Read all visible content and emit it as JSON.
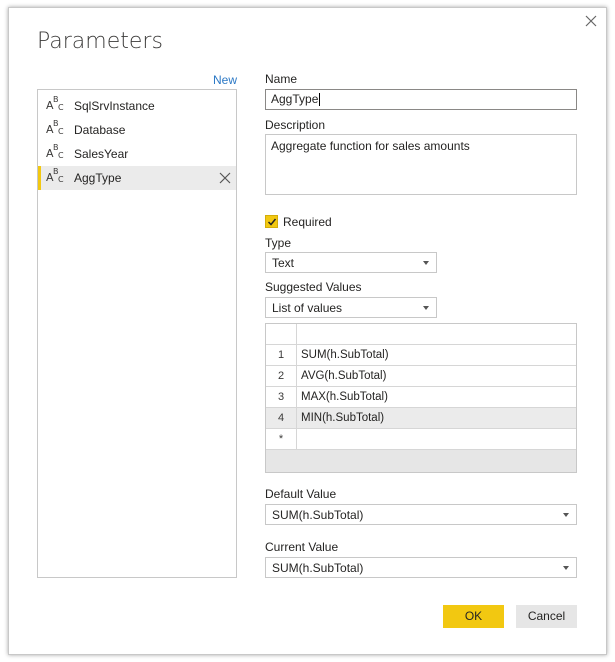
{
  "dialog": {
    "title": "Parameters",
    "new_link": "New",
    "close_icon": "close-icon"
  },
  "parameters": [
    {
      "label": "SqlSrvInstance",
      "icon": "text-type-icon"
    },
    {
      "label": "Database",
      "icon": "text-type-icon"
    },
    {
      "label": "SalesYear",
      "icon": "text-type-icon"
    },
    {
      "label": "AggType",
      "icon": "text-type-icon",
      "selected": true
    }
  ],
  "form": {
    "name_label": "Name",
    "name_value": "AggType",
    "description_label": "Description",
    "description_value": "Aggregate function for sales amounts",
    "required_label": "Required",
    "required_checked": true,
    "type_label": "Type",
    "type_value": "Text",
    "suggested_label": "Suggested Values",
    "suggested_value": "List of values",
    "values_table": {
      "rows": [
        {
          "num": "1",
          "value": "SUM(h.SubTotal)"
        },
        {
          "num": "2",
          "value": "AVG(h.SubTotal)"
        },
        {
          "num": "3",
          "value": "MAX(h.SubTotal)"
        },
        {
          "num": "4",
          "value": "MIN(h.SubTotal)"
        }
      ],
      "new_row_marker": "*"
    },
    "default_label": "Default Value",
    "default_value": "SUM(h.SubTotal)",
    "current_label": "Current Value",
    "current_value": "SUM(h.SubTotal)"
  },
  "buttons": {
    "ok": "OK",
    "cancel": "Cancel"
  },
  "colors": {
    "accent": "#f2c811",
    "link": "#2b78c5"
  }
}
